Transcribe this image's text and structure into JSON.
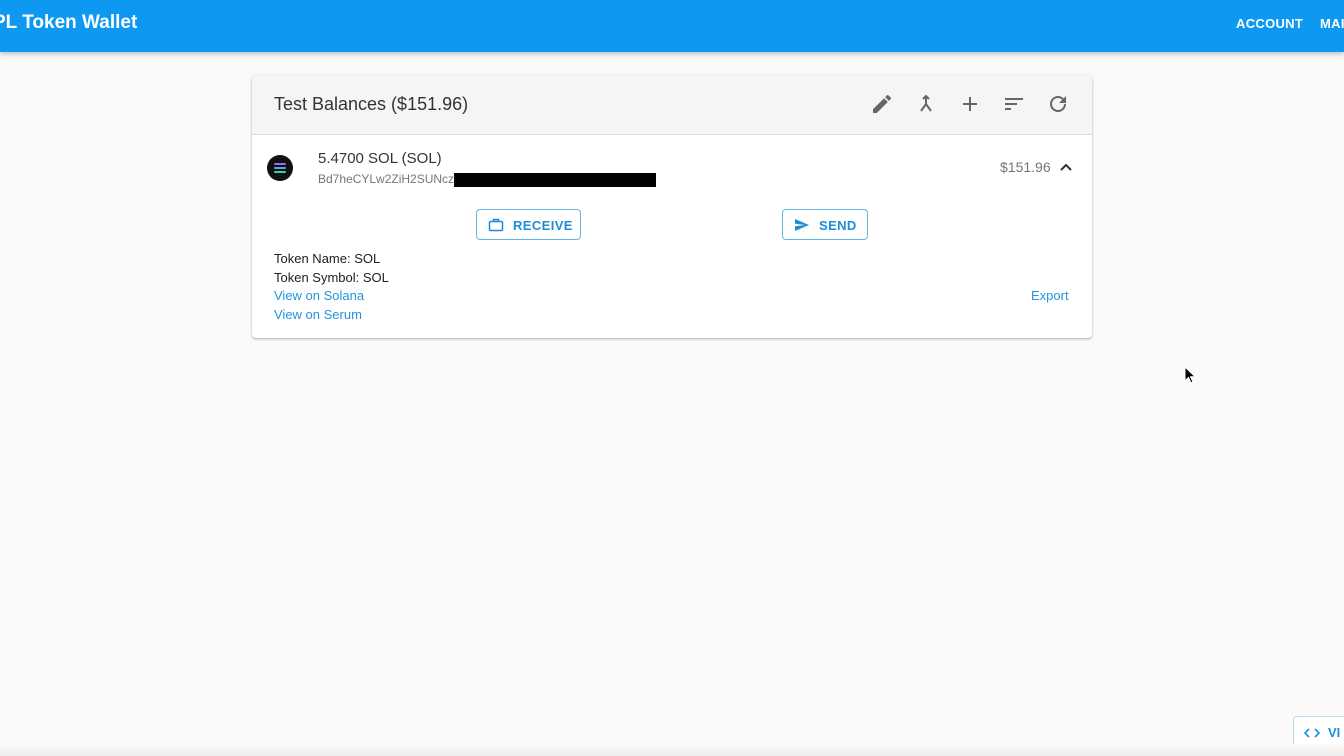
{
  "appbar": {
    "title": "PL Token Wallet",
    "nav": [
      {
        "label": "ACCOUNT"
      },
      {
        "label": "MAI"
      }
    ]
  },
  "card": {
    "title": "Test Balances ($151.96)",
    "header_actions": [
      "edit-icon",
      "merge-icon",
      "add-icon",
      "sort-icon",
      "refresh-icon"
    ],
    "token": {
      "icon": "solana-logo",
      "balance": "5.4700 SOL (SOL)",
      "address": "Bd7heCYLw2ZiH2SUNcz",
      "usd_value": "$151.96",
      "receive_label": "RECEIVE",
      "send_label": "SEND",
      "token_name": "Token Name: SOL",
      "token_symbol": "Token Symbol: SOL",
      "view_solana": "View on Solana",
      "view_serum": "View on Serum",
      "export": "Export"
    }
  },
  "corner_button": {
    "label": "VI",
    "icon": "code-icon"
  },
  "colors": {
    "appbar": "#0d99f2",
    "accent": "#1d8fd8",
    "background": "#fafafa"
  }
}
